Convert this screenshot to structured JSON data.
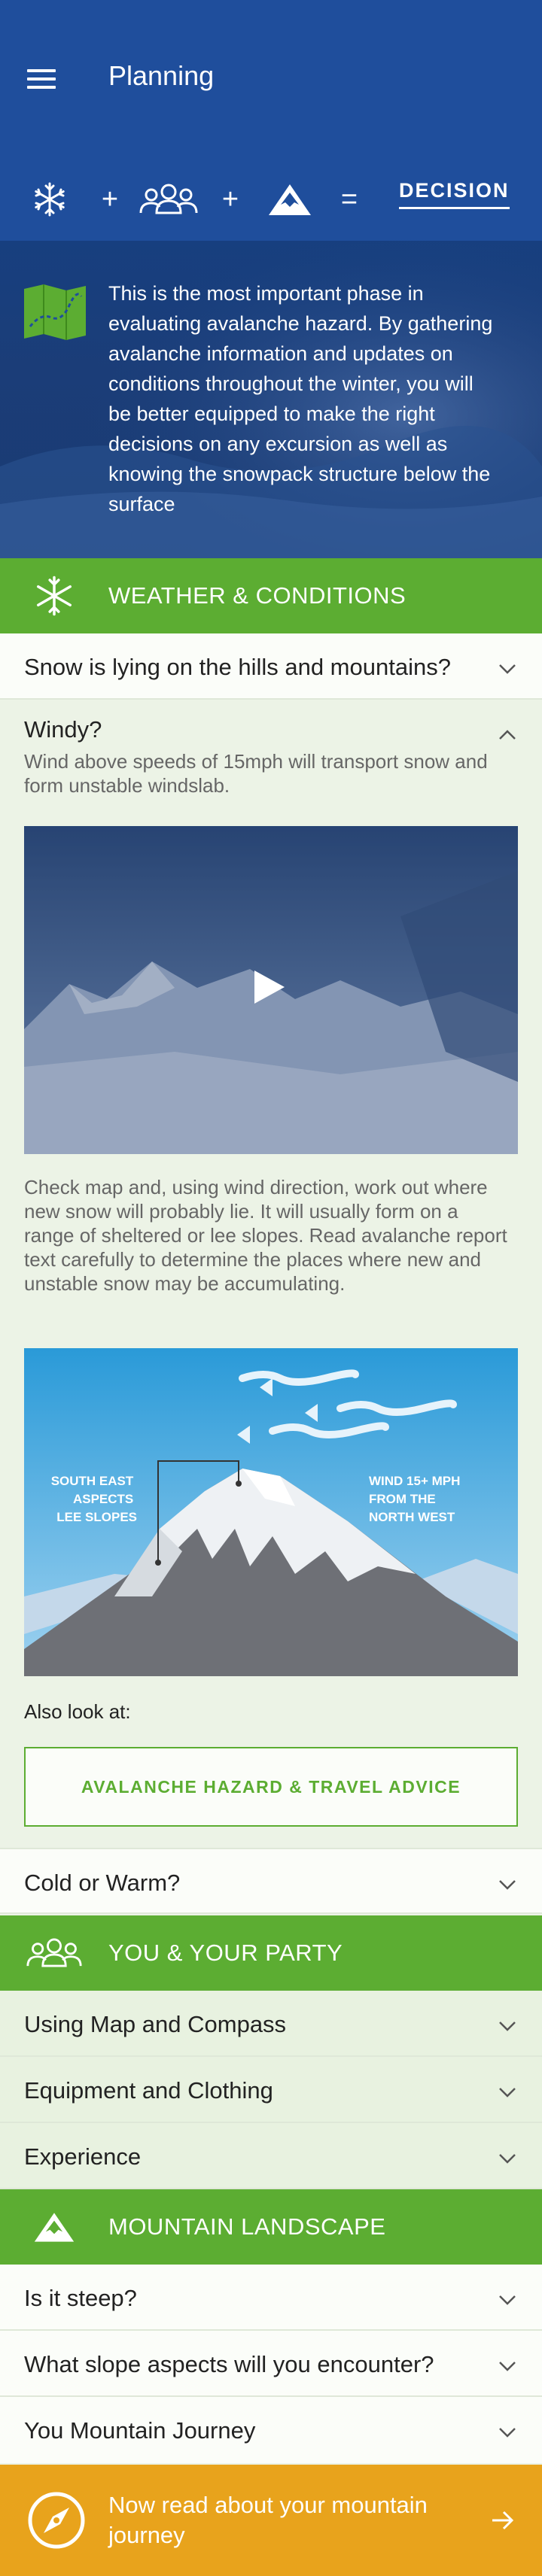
{
  "header": {
    "title": "Planning"
  },
  "formula": {
    "plus1": "+",
    "plus2": "+",
    "equals": "=",
    "decision": "DECISION"
  },
  "intro": {
    "text": "This is the most important phase in evaluating avalanche hazard. By gathering avalanche information and updates on conditions throughout the winter, you will be better equipped to make the right decisions on any excursion as well as knowing the snowpack structure below the surface"
  },
  "sections": {
    "weather": {
      "title": "WEATHER & CONDITIONS",
      "rows": [
        {
          "label": "Snow is lying on the hills and mountains?"
        },
        {
          "label": "Windy?"
        },
        {
          "label": "Cold or Warm?"
        }
      ],
      "windy": {
        "subtitle": "Wind above speeds of 15mph will transport snow and form unstable windslab.",
        "description": "Check map and, using wind direction, work out where new snow will probably lie. It will usually form on a range of sheltered or lee slopes. Read avalanche report text carefully to determine the places where new and unstable snow may be accumulating.",
        "illustration": {
          "left_label": [
            "SOUTH EAST",
            "ASPECTS",
            "LEE SLOPES"
          ],
          "right_label": [
            "WIND 15+ MPH",
            "FROM THE",
            "NORTH WEST"
          ]
        },
        "also_look": "Also look at:",
        "hazard_button": "AVALANCHE HAZARD & TRAVEL ADVICE"
      }
    },
    "party": {
      "title": "YOU & YOUR PARTY",
      "rows": [
        {
          "label": "Using Map and Compass"
        },
        {
          "label": "Equipment and Clothing"
        },
        {
          "label": "Experience"
        }
      ]
    },
    "landscape": {
      "title": "MOUNTAIN LANDSCAPE",
      "rows": [
        {
          "label": "Is it steep?"
        },
        {
          "label": "What slope aspects will you encounter?"
        },
        {
          "label": "You Mountain Journey"
        }
      ]
    }
  },
  "footer": {
    "text": "Now read about your mountain journey"
  },
  "colors": {
    "blue": "#1f4e9c",
    "green": "#5cad32",
    "orange": "#e8a31c"
  }
}
